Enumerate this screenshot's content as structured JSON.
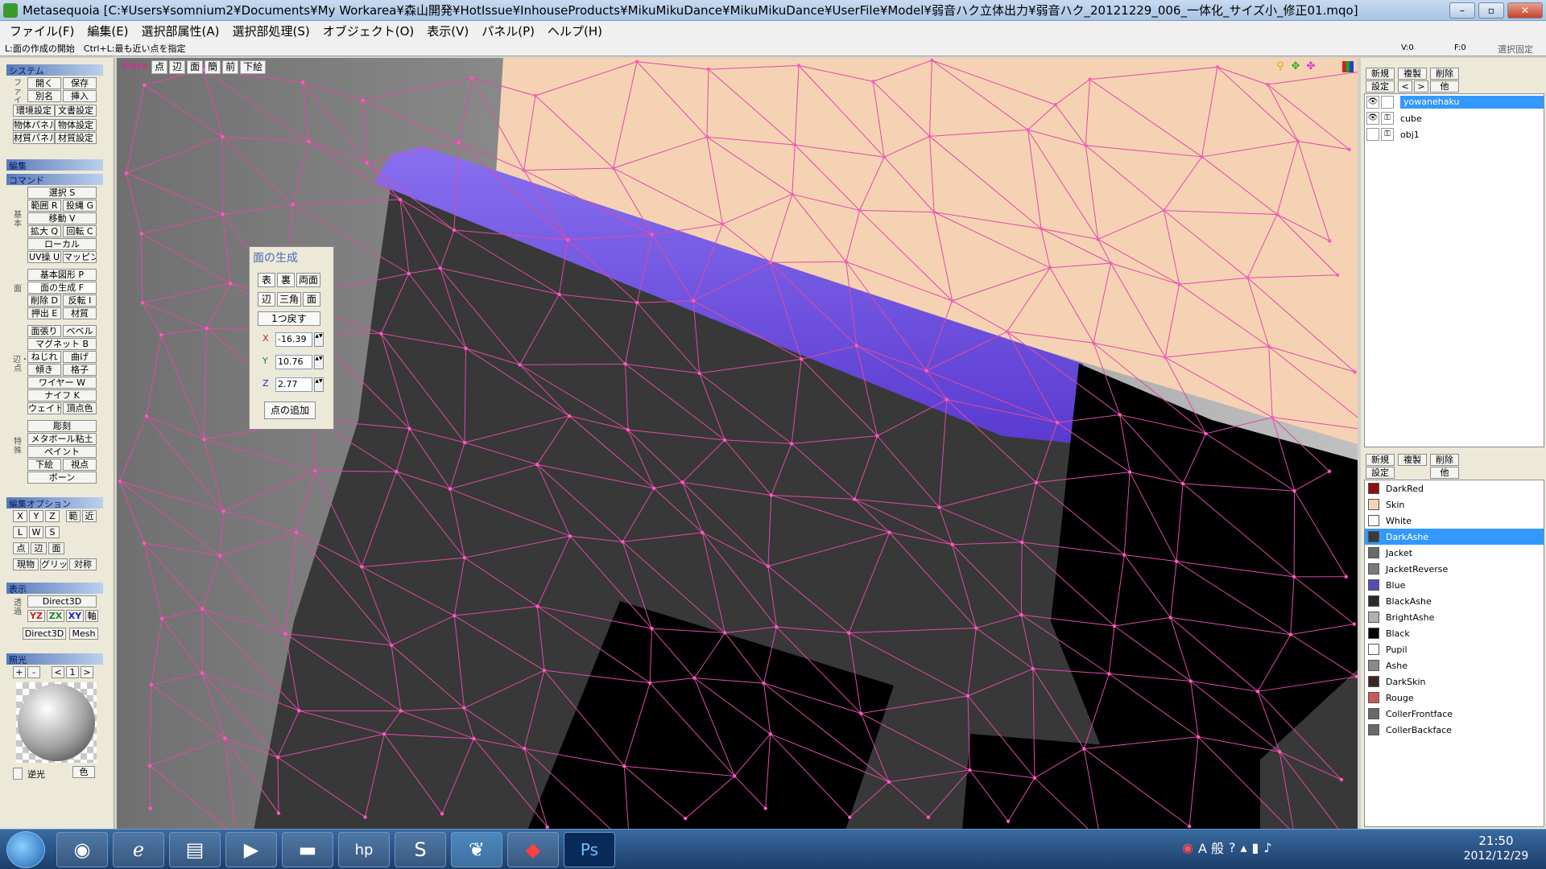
{
  "title": "Metasequoia [C:¥Users¥somnium2¥Documents¥My Workarea¥森山開発¥HotIssue¥InhouseProducts¥MikuMikuDance¥MikuMikuDance¥UserFile¥Model¥弱音ハク立体出力¥弱音ハク_20121229_006_一体化_サイズ小_修正01.mqo]",
  "window_buttons": {
    "minimize": "–",
    "maximize": "▫",
    "close": "✕"
  },
  "menu": [
    "ファイル(F)",
    "編集(E)",
    "選択部属性(A)",
    "選択部処理(S)",
    "オブジェクト(O)",
    "表示(V)",
    "パネル(P)",
    "ヘルプ(H)"
  ],
  "status": {
    "hint": "L:面の作成の開始　Ctrl+L:最も近い点を指定",
    "vertex_count": "V:0",
    "face_count": "F:0",
    "lock_selection": "選択固定"
  },
  "left_panel": {
    "system": {
      "header": "システム",
      "side_label": "ファイル",
      "open": "開く",
      "save": "保存",
      "save_as": "別名",
      "insert": "挿入",
      "env_settings": "環境設定",
      "doc_settings": "文書設定",
      "object_panel": "物体パネル",
      "object_settings": "物体設定",
      "material_panel": "材質パネル",
      "material_settings": "材質設定"
    },
    "edit": {
      "header": "編集",
      "command_header": "コマンド"
    },
    "commands": {
      "side_basic": "基本",
      "select": "選択 S",
      "range": "範囲 R",
      "lasso": "投縄 G",
      "move": "移動 V",
      "scale": "拡大 Q",
      "rotate": "回転 C",
      "local": "ローカル",
      "uv": "UV操 U",
      "mapping": "マッピング",
      "side_face": "面",
      "basic_shape": "基本図形 P",
      "face_create": "面の生成 F",
      "delete": "削除 D",
      "reverse": "反転 I",
      "extrude": "押出 E",
      "material": "材質",
      "side_edge": "辺・点",
      "face_stretch": "面張り",
      "bevel": "ベベル",
      "magnet": "マグネット B",
      "twist": "ねじれ",
      "bend": "曲げ",
      "tilt": "傾き",
      "lattice": "格子",
      "wire": "ワイヤー W",
      "knife": "ナイフ K",
      "weight": "ウェイト",
      "vertex_color": "頂点色",
      "side_special": "特殊",
      "sculpt": "彫刻",
      "metaball": "メタボール粘土",
      "paint": "ペイント",
      "underlay": "下絵",
      "viewpoint": "視点",
      "bone": "ボーン"
    },
    "edit_options": {
      "header": "編集オプション",
      "x": "X",
      "y": "Y",
      "z": "Z",
      "range": "範",
      "neighbor": "近",
      "l": "L",
      "w": "W",
      "s": "S",
      "vertex": "点",
      "edge": "辺",
      "face": "面",
      "current": "現物",
      "grid": "グリッド",
      "symmetry": "対称"
    },
    "display": {
      "header": "表示",
      "side_label": "透過",
      "direct3d": "Direct3D",
      "yz": "YZ",
      "zx": "ZX",
      "xy": "XY",
      "axis": "軸",
      "direct3d_2": "Direct3D",
      "mesh": "Mesh"
    },
    "lighting": {
      "header": "照光",
      "plus": "+",
      "minus": "-",
      "prev": "<",
      "value": "1",
      "next": ">",
      "backlight": "逆光",
      "color": "色"
    }
  },
  "viewport": {
    "mode": "Pers",
    "tabs": [
      "点",
      "辺",
      "面",
      "簡",
      "前",
      "下絵"
    ]
  },
  "face_panel": {
    "title": "面の生成",
    "front": "表",
    "back": "裏",
    "both": "両面",
    "edge": "辺",
    "triangle": "三角",
    "face": "面",
    "undo": "1つ戻す",
    "x_label": "X",
    "x_value": "-16.39",
    "y_label": "Y",
    "y_value": "10.76",
    "z_label": "Z",
    "z_value": "2.77",
    "add_point": "点の追加"
  },
  "object_panel": {
    "new": "新規",
    "clone": "複製",
    "delete": "削除",
    "settings": "設定",
    "prev": "<",
    "next": ">",
    "other": "他",
    "objects": [
      {
        "name": "yowanehaku",
        "selected": true
      },
      {
        "name": "cube",
        "selected": false
      },
      {
        "name": "obj1",
        "selected": false
      }
    ]
  },
  "material_panel": {
    "new": "新規",
    "clone": "複製",
    "delete": "削除",
    "settings": "設定",
    "other": "他",
    "materials": [
      {
        "name": "DarkRed",
        "color": "#8b1010"
      },
      {
        "name": "Skin",
        "color": "#f6d2b4"
      },
      {
        "name": "White",
        "color": "#ffffff"
      },
      {
        "name": "DarkAshe",
        "color": "#3a3a3a",
        "selected": true
      },
      {
        "name": "Jacket",
        "color": "#6a6a6a"
      },
      {
        "name": "JacketReverse",
        "color": "#7a7a7a"
      },
      {
        "name": "Blue",
        "color": "#5a4ab8"
      },
      {
        "name": "BlackAshe",
        "color": "#2a2a2a"
      },
      {
        "name": "BrightAshe",
        "color": "#b0b0b0"
      },
      {
        "name": "Black",
        "color": "#000000"
      },
      {
        "name": "Pupil",
        "color": "#ffffff"
      },
      {
        "name": "Ashe",
        "color": "#8a8a8a"
      },
      {
        "name": "DarkSkin",
        "color": "#3a2820"
      },
      {
        "name": "Rouge",
        "color": "#c85a5a"
      },
      {
        "name": "CollerFrontface",
        "color": "#6a6a6a"
      },
      {
        "name": "CollerBackface",
        "color": "#6a6a6a"
      }
    ]
  },
  "taskbar": {
    "apps": [
      "chrome-icon",
      "ie-icon",
      "explorer-icon",
      "media-player-icon",
      "app-icon",
      "hp-icon",
      "s-app-icon",
      "metasequoia-icon",
      "acrobat-icon",
      "photoshop-icon"
    ],
    "ps_label": "Ps",
    "hp_label": "hp",
    "s_label": "S",
    "ime_mode": "A 般",
    "time": "21:50",
    "date": "2012/12/29"
  }
}
